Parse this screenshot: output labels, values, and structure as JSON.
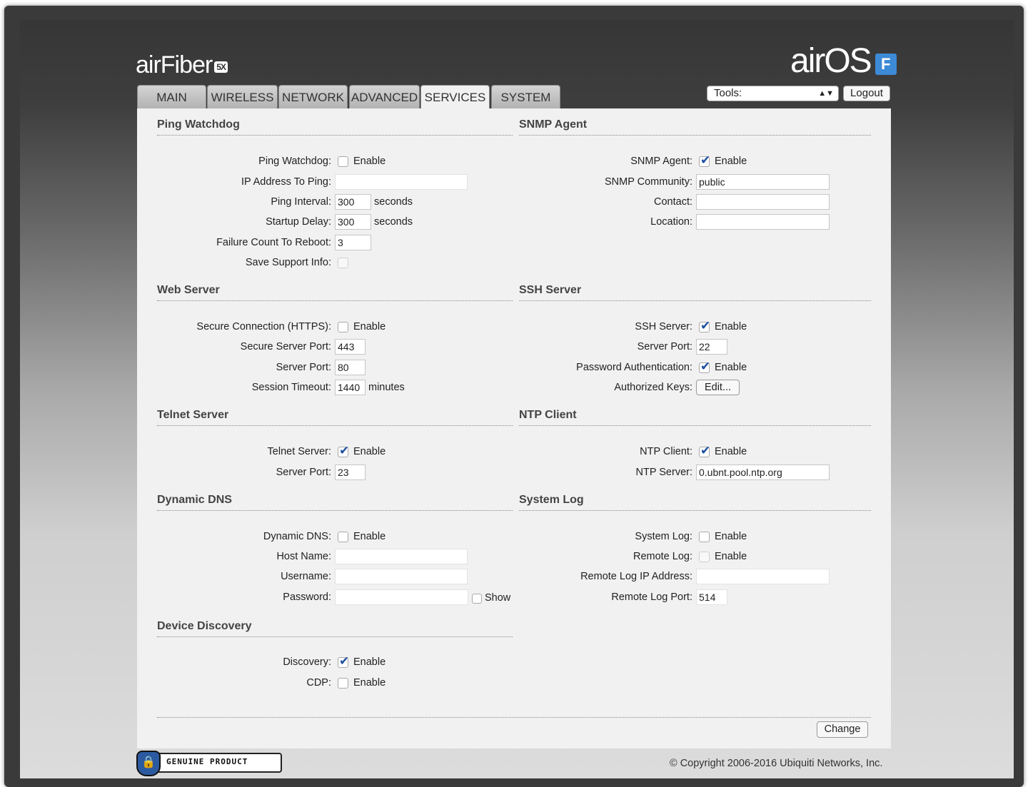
{
  "header": {
    "brand_left": "airFiber",
    "brand_left_badge": "5X",
    "brand_right": "airOS",
    "brand_right_badge": "F",
    "tabs": [
      {
        "label": "MAIN",
        "active": false
      },
      {
        "label": "WIRELESS",
        "active": false
      },
      {
        "label": "NETWORK",
        "active": false
      },
      {
        "label": "ADVANCED",
        "active": false
      },
      {
        "label": "SERVICES",
        "active": true
      },
      {
        "label": "SYSTEM",
        "active": false
      }
    ],
    "tools_label": "Tools:",
    "logout_label": "Logout"
  },
  "ping_watchdog": {
    "title": "Ping Watchdog",
    "ping_watchdog_label": "Ping Watchdog:",
    "enable_label": "Enable",
    "enabled": false,
    "ip_label": "IP Address To Ping:",
    "ip_value": "",
    "interval_label": "Ping Interval:",
    "interval_value": "300",
    "interval_unit": "seconds",
    "startup_label": "Startup Delay:",
    "startup_value": "300",
    "startup_unit": "seconds",
    "failure_label": "Failure Count To Reboot:",
    "failure_value": "3",
    "support_label": "Save Support Info:"
  },
  "snmp": {
    "title": "SNMP Agent",
    "agent_label": "SNMP Agent:",
    "enable_label": "Enable",
    "enabled": true,
    "community_label": "SNMP Community:",
    "community_value": "public",
    "contact_label": "Contact:",
    "contact_value": "",
    "location_label": "Location:",
    "location_value": ""
  },
  "web_server": {
    "title": "Web Server",
    "https_label": "Secure Connection (HTTPS):",
    "enable_label": "Enable",
    "https_enabled": false,
    "secure_port_label": "Secure Server Port:",
    "secure_port_value": "443",
    "port_label": "Server Port:",
    "port_value": "80",
    "timeout_label": "Session Timeout:",
    "timeout_value": "1440",
    "timeout_unit": "minutes"
  },
  "ssh_server": {
    "title": "SSH Server",
    "server_label": "SSH Server:",
    "enable_label": "Enable",
    "enabled": true,
    "port_label": "Server Port:",
    "port_value": "22",
    "password_auth_label": "Password Authentication:",
    "password_auth_enabled": true,
    "keys_label": "Authorized Keys:",
    "edit_label": "Edit..."
  },
  "telnet": {
    "title": "Telnet Server",
    "server_label": "Telnet Server:",
    "enable_label": "Enable",
    "enabled": true,
    "port_label": "Server Port:",
    "port_value": "23"
  },
  "ntp": {
    "title": "NTP Client",
    "client_label": "NTP Client:",
    "enable_label": "Enable",
    "enabled": true,
    "server_label": "NTP Server:",
    "server_value": "0.ubnt.pool.ntp.org"
  },
  "ddns": {
    "title": "Dynamic DNS",
    "ddns_label": "Dynamic DNS:",
    "enable_label": "Enable",
    "enabled": false,
    "host_label": "Host Name:",
    "host_value": "",
    "username_label": "Username:",
    "username_value": "",
    "password_label": "Password:",
    "password_value": "",
    "show_label": "Show"
  },
  "syslog": {
    "title": "System Log",
    "system_label": "System Log:",
    "enable_label": "Enable",
    "system_enabled": false,
    "remote_label": "Remote Log:",
    "remote_enabled": false,
    "remote_ip_label": "Remote Log IP Address:",
    "remote_ip_value": "",
    "remote_port_label": "Remote Log Port:",
    "remote_port_value": "514"
  },
  "discovery": {
    "title": "Device Discovery",
    "discovery_label": "Discovery:",
    "enable_label": "Enable",
    "discovery_enabled": true,
    "cdp_label": "CDP:",
    "cdp_enabled": false
  },
  "footer": {
    "change_label": "Change",
    "genuine_text": "GENUINE PRODUCT",
    "copyright": "© Copyright 2006-2016 Ubiquiti Networks, Inc."
  }
}
